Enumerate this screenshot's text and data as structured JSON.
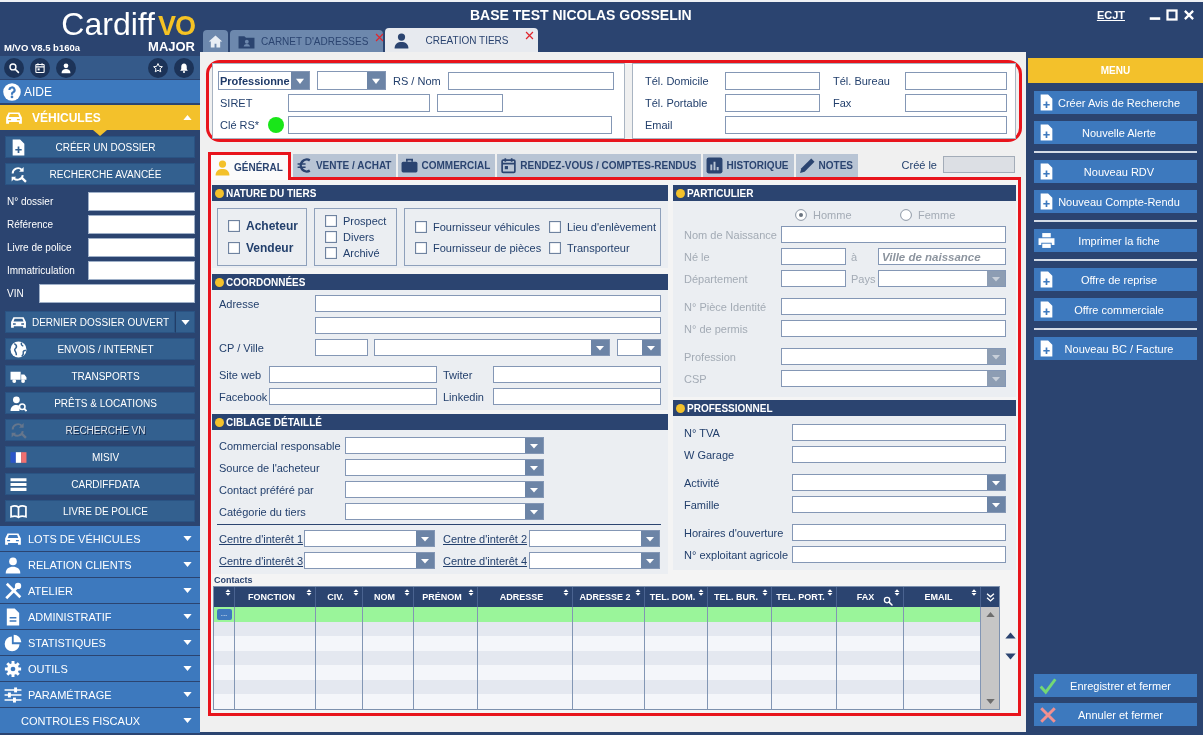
{
  "window": {
    "title": "BASE TEST NICOLAS GOSSELIN",
    "user_link": "ECJT"
  },
  "sidebar": {
    "logo": {
      "name": "Cardiff",
      "accent": "VO",
      "edition": "MAJOR"
    },
    "version": "M/VO V8.5 b160a",
    "help": "AIDE",
    "active_section": {
      "label": "VÉHICULES",
      "expanded": true
    },
    "actions": [
      {
        "label": "CRÉER UN DOSSIER"
      },
      {
        "label": "RECHERCHE AVANCÉE"
      }
    ],
    "search_fields": [
      {
        "label": "N° dossier"
      },
      {
        "label": "Référence"
      },
      {
        "label": "Livre de police"
      },
      {
        "label": "Immatriculation"
      },
      {
        "label": "VIN"
      }
    ],
    "links": [
      {
        "label": "DERNIER DOSSIER OUVERT",
        "kind": "split",
        "disabled": false
      },
      {
        "label": "ENVOIS / INTERNET",
        "kind": "plain",
        "disabled": false
      },
      {
        "label": "TRANSPORTS",
        "kind": "plain",
        "disabled": false
      },
      {
        "label": "PRÊTS & LOCATIONS",
        "kind": "plain",
        "disabled": false
      },
      {
        "label": "RECHERCHE VN",
        "kind": "plain",
        "disabled": true
      },
      {
        "label": "MISIV",
        "kind": "plain",
        "disabled": false
      },
      {
        "label": "CARDIFFDATA",
        "kind": "plain",
        "disabled": false
      },
      {
        "label": "LIVRE DE POLICE",
        "kind": "plain",
        "disabled": false
      }
    ],
    "sections": [
      {
        "label": "LOTS DE VÉHICULES",
        "expanded": false
      },
      {
        "label": "RELATION CLIENTS",
        "expanded": false
      },
      {
        "label": "ATELIER",
        "expanded": false
      },
      {
        "label": "ADMINISTRATIF",
        "expanded": false
      },
      {
        "label": "STATISTIQUES",
        "expanded": false
      },
      {
        "label": "OUTILS",
        "expanded": false
      },
      {
        "label": "PARAMÉTRAGE",
        "expanded": false
      },
      {
        "label": "CONTROLES FISCAUX",
        "expanded": false
      }
    ]
  },
  "doc_tabs": [
    {
      "kind": "home",
      "selected": false
    },
    {
      "kind": "document",
      "label": "CARNET D'ADRESSES",
      "selected": false
    },
    {
      "kind": "document",
      "label": "CREATION TIERS",
      "selected": true
    }
  ],
  "identity": {
    "highlighted": true,
    "type_value": "Professionne",
    "name_label": "RS / Nom",
    "siret_label": "SIRET",
    "key": {
      "label": "Clé RS*",
      "valid": true
    },
    "phones": [
      {
        "label": "Tél. Domicile"
      },
      {
        "label": "Tél. Bureau"
      },
      {
        "label": "Tél. Portable"
      },
      {
        "label": "Fax"
      }
    ],
    "email_label": "Email"
  },
  "form": {
    "highlighted": true,
    "tabs": [
      {
        "label": "GÉNÉRAL",
        "selected": true
      },
      {
        "label": "VENTE / ACHAT",
        "selected": false
      },
      {
        "label": "COMMERCIAL",
        "selected": false
      },
      {
        "label": "RENDEZ-VOUS / COMPTES-RENDUS",
        "selected": false
      },
      {
        "label": "HISTORIQUE",
        "selected": false
      },
      {
        "label": "NOTES",
        "selected": false
      }
    ],
    "created_label": "Créé le"
  },
  "nature": {
    "title": "NATURE DU TIERS",
    "groups": [
      {
        "items": [
          {
            "label": "Acheteur",
            "checked": false
          },
          {
            "label": "Vendeur",
            "checked": false
          }
        ]
      },
      {
        "items": [
          {
            "label": "Prospect",
            "checked": false
          },
          {
            "label": "Divers",
            "checked": false
          },
          {
            "label": "Archivé",
            "checked": false
          }
        ]
      },
      {
        "items": [
          {
            "label": "Fournisseur véhicules",
            "checked": false
          },
          {
            "label": "Lieu d'enlèvement",
            "checked": false
          },
          {
            "label": "Fournisseur de pièces",
            "checked": false
          },
          {
            "label": "Transporteur",
            "checked": false
          }
        ]
      }
    ]
  },
  "coordonnees": {
    "title": "COORDONNÉES",
    "address_label": "Adresse",
    "city_label": "CP / Ville",
    "web": [
      {
        "label": "Site web"
      },
      {
        "label": "Twiter"
      },
      {
        "label": "Facebook"
      },
      {
        "label": "Linkedin"
      }
    ]
  },
  "ciblage": {
    "title": "CIBLAGE DÉTAILLÉ",
    "selects": [
      {
        "label": "Commercial responsable"
      },
      {
        "label": "Source de l'acheteur"
      },
      {
        "label": "Contact préféré par"
      },
      {
        "label": "Catégorie du tiers"
      }
    ],
    "interests": [
      {
        "label": "Centre d'interêt 1"
      },
      {
        "label": "Centre d'interêt 2"
      },
      {
        "label": "Centre d'interêt 3"
      },
      {
        "label": "Centre d'interêt 4"
      }
    ]
  },
  "particulier": {
    "title": "PARTICULIER",
    "disabled": true,
    "gender": [
      {
        "label": "Homme",
        "selected": true
      },
      {
        "label": "Femme",
        "selected": false
      }
    ],
    "birth_name_label": "Nom de Naissance",
    "birth_date_label": "Né le",
    "birth_place_label": "à",
    "birth_place_placeholder": "Ville de naissance",
    "department_label": "Département",
    "country_label": "Pays",
    "id_label": "N° Pièce Identité",
    "license_label": "N° de permis",
    "profession_label": "Profession",
    "csp_label": "CSP"
  },
  "professionnel": {
    "title": "PROFESSIONNEL",
    "fields": [
      {
        "label": "N° TVA",
        "kind": "text"
      },
      {
        "label": "W Garage",
        "kind": "text"
      },
      {
        "label": "Activité",
        "kind": "select"
      },
      {
        "label": "Famille",
        "kind": "select"
      },
      {
        "label": "Horaires d'ouverture",
        "kind": "text"
      },
      {
        "label": "N° exploitant agricole",
        "kind": "text"
      }
    ]
  },
  "contacts": {
    "title": "Contacts",
    "columns": [
      {
        "label": "FONCTION",
        "searchable": false
      },
      {
        "label": "CIV.",
        "searchable": false
      },
      {
        "label": "NOM",
        "searchable": false
      },
      {
        "label": "PRÉNOM",
        "searchable": false
      },
      {
        "label": "ADRESSE",
        "searchable": false
      },
      {
        "label": "ADRESSE 2",
        "searchable": false
      },
      {
        "label": "TEL. DOM.",
        "searchable": false
      },
      {
        "label": "TEL. BUR.",
        "searchable": false
      },
      {
        "label": "TEL. PORT.",
        "searchable": false
      },
      {
        "label": "FAX",
        "searchable": true
      },
      {
        "label": "EMAIL",
        "searchable": false
      }
    ],
    "rows": [
      {
        "selected": true,
        "action": "..."
      },
      {
        "selected": false
      },
      {
        "selected": false
      },
      {
        "selected": false
      },
      {
        "selected": false
      },
      {
        "selected": false
      },
      {
        "selected": false
      }
    ]
  },
  "menu": {
    "title": "MENU",
    "groups": [
      {
        "items": [
          {
            "label": "Créer Avis de Recherche",
            "kind": "new"
          },
          {
            "label": "Nouvelle Alerte",
            "kind": "new"
          }
        ]
      },
      {
        "items": [
          {
            "label": "Nouveau RDV",
            "kind": "new"
          },
          {
            "label": "Nouveau Compte-Rendu",
            "kind": "new"
          }
        ]
      },
      {
        "items": [
          {
            "label": "Imprimer la fiche",
            "kind": "print"
          }
        ]
      },
      {
        "items": [
          {
            "label": "Offre de reprise",
            "kind": "new"
          },
          {
            "label": "Offre commerciale",
            "kind": "new"
          }
        ]
      },
      {
        "items": [
          {
            "label": "Nouveau BC / Facture",
            "kind": "new"
          }
        ]
      }
    ],
    "footer": [
      {
        "label": "Enregistrer et fermer",
        "kind": "confirm"
      },
      {
        "label": "Annuler et fermer",
        "kind": "cancel"
      }
    ]
  }
}
